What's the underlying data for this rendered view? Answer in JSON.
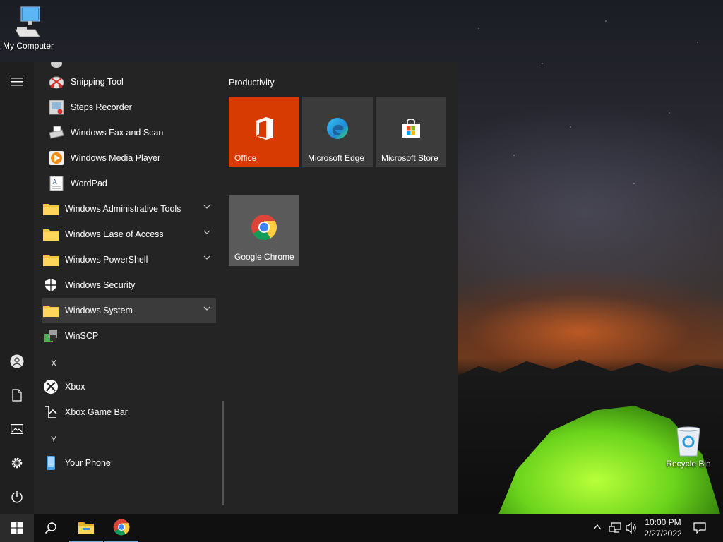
{
  "desktop": {
    "icons": [
      {
        "label": "My Computer"
      },
      {
        "label": "Recycle Bin"
      }
    ]
  },
  "start_menu": {
    "rail_icons": [
      "hamburger-menu-icon",
      "user-account-icon",
      "documents-icon",
      "pictures-icon",
      "settings-icon",
      "power-icon"
    ],
    "apps": [
      {
        "label": "Snipping Tool",
        "icon": "snipping-tool-icon"
      },
      {
        "label": "Steps Recorder",
        "icon": "steps-recorder-icon"
      },
      {
        "label": "Windows Fax and Scan",
        "icon": "fax-scan-icon"
      },
      {
        "label": "Windows Media Player",
        "icon": "media-player-icon"
      },
      {
        "label": "WordPad",
        "icon": "wordpad-icon"
      },
      {
        "label": "Windows Administrative Tools",
        "icon": "folder-icon",
        "expandable": true
      },
      {
        "label": "Windows Ease of Access",
        "icon": "folder-icon",
        "expandable": true
      },
      {
        "label": "Windows PowerShell",
        "icon": "folder-icon",
        "expandable": true
      },
      {
        "label": "Windows Security",
        "icon": "shield-icon"
      },
      {
        "label": "Windows System",
        "icon": "folder-icon",
        "expandable": true,
        "selected": true
      },
      {
        "label": "WinSCP",
        "icon": "winscp-icon"
      },
      {
        "letter": "X"
      },
      {
        "label": "Xbox",
        "icon": "xbox-icon"
      },
      {
        "label": "Xbox Game Bar",
        "icon": "xbox-game-bar-icon"
      },
      {
        "letter": "Y"
      },
      {
        "label": "Your Phone",
        "icon": "phone-icon"
      }
    ],
    "tile_group": {
      "title": "Productivity",
      "tiles": [
        {
          "label": "Office",
          "color": "#d83b01",
          "icon": "office-icon"
        },
        {
          "label": "Microsoft Edge",
          "color": "#3b3b3b",
          "icon": "edge-icon"
        },
        {
          "label": "Microsoft Store",
          "color": "#3b3b3b",
          "icon": "store-icon"
        },
        {
          "label": "Google Chrome",
          "color": "#5a5a5a",
          "icon": "chrome-icon"
        }
      ]
    }
  },
  "taskbar": {
    "pinned": [
      "windows-start-icon",
      "search-icon",
      "file-explorer-icon",
      "chrome-icon"
    ],
    "tray": [
      "chevron-up-icon",
      "network-icon",
      "volume-icon"
    ],
    "time": "10:00 PM",
    "date": "2/27/2022",
    "notification_icon": "action-center-icon"
  }
}
